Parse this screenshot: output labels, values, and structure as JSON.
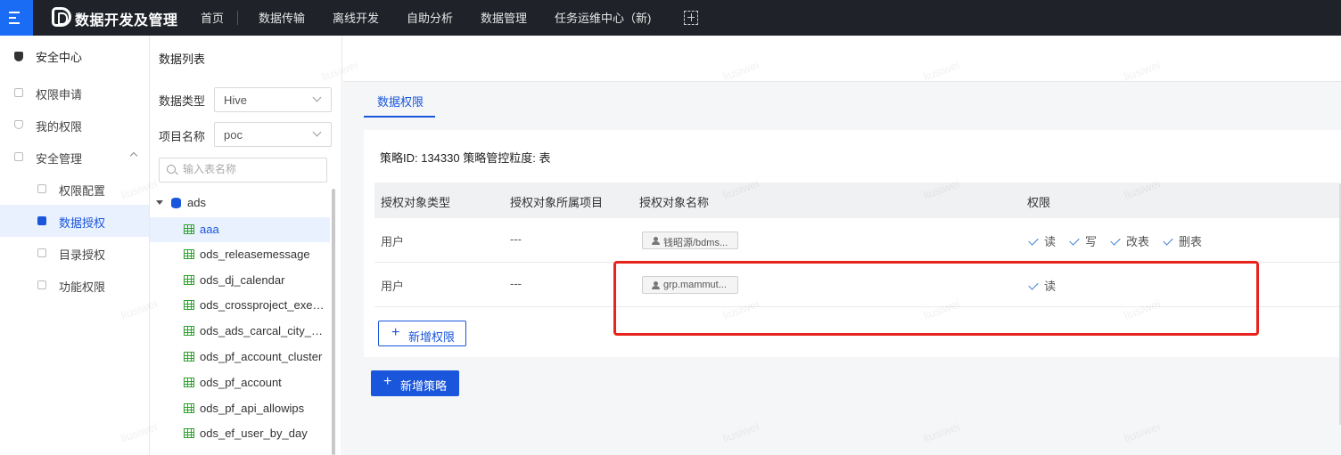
{
  "app": {
    "title": "数据开发及管理"
  },
  "nav": [
    "首页",
    "数据传输",
    "离线开发",
    "自助分析",
    "数据管理",
    "任务运维中心（新)"
  ],
  "sidebar": {
    "header": "安全中心",
    "items": [
      {
        "label": "权限申请"
      },
      {
        "label": "我的权限"
      },
      {
        "label": "安全管理"
      },
      {
        "label": "权限配置"
      },
      {
        "label": "数据授权"
      },
      {
        "label": "目录授权"
      },
      {
        "label": "功能权限"
      }
    ]
  },
  "datalist": {
    "title": "数据列表",
    "type_label": "数据类型",
    "type_value": "Hive",
    "project_label": "项目名称",
    "project_value": "poc",
    "search_placeholder": "输入表名称",
    "db": "ads",
    "tables": [
      "aaa",
      "ods_releasemessage",
      "ods_dj_calendar",
      "ods_crossproject_execution",
      "ods_ads_carcal_city_config",
      "ods_pf_account_cluster",
      "ods_pf_account",
      "ods_pf_api_allowips",
      "ods_ef_user_by_day"
    ]
  },
  "main": {
    "tab": "数据权限",
    "policy_info": "策略ID: 134330  策略管控粒度: 表",
    "columns": [
      "授权对象类型",
      "授权对象所属项目",
      "授权对象名称",
      "权限"
    ],
    "rows": [
      {
        "type": "用户",
        "project": "---",
        "name": "钱昭源/bdms...",
        "perms": [
          "读",
          "写",
          "改表",
          "删表"
        ]
      },
      {
        "type": "用户",
        "project": "---",
        "name": "grp.mammut...",
        "perms": [
          "读"
        ]
      }
    ],
    "add_perm": "新增权限",
    "add_policy": "新增策略"
  },
  "watermark": "liusiwei",
  "colors": {
    "accent": "#1a56db",
    "highlight": "#e8221c",
    "topbar": "#1f2329"
  }
}
